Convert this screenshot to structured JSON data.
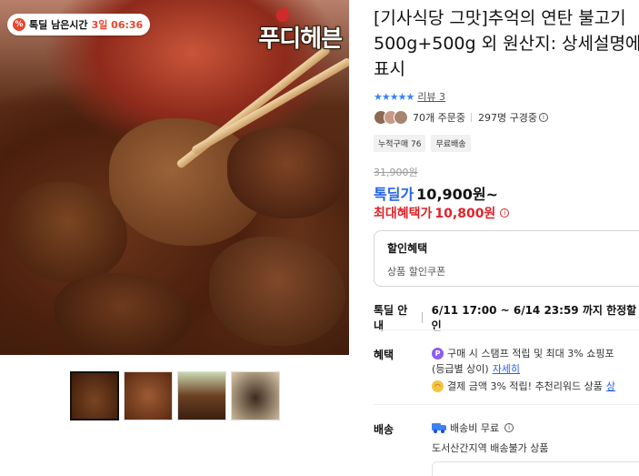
{
  "timer": {
    "icon": "percent-icon",
    "label": "톡딜 남은시간",
    "value": "3일 06:36"
  },
  "brand": {
    "name": "푸디헤븐"
  },
  "product": {
    "title": "[기사식당 그맛]추억의 연탄 불고기 500g+500g 외 원산지: 상세설명에 표시"
  },
  "rating": {
    "stars": "★★★★★",
    "review_label": "리뷰 3"
  },
  "buyers": {
    "orders": "70개 주문중",
    "subscribers": "297명 구경중"
  },
  "tags": [
    "누적구매 76",
    "무료배송"
  ],
  "price": {
    "original": "31,900원",
    "deal_label": "톡딜가",
    "deal_price": "10,900원~",
    "max_label": "최대혜택가",
    "max_price": "10,800원"
  },
  "discount": {
    "title": "할인혜택",
    "subtitle": "상품 할인쿠폰"
  },
  "deal_info": {
    "label": "톡딜 안내",
    "value": "6/11 17:00 ~ 6/14 23:59 까지 한정할인"
  },
  "benefits": {
    "label": "혜택",
    "line1": "구매 시 스탬프 적립 및 최대 3% 쇼핑포",
    "line2_text": "(등급별 상이)",
    "line2_link": "자세히",
    "line3_text": "결제 금액 3% 적립! 추천리워드 상품",
    "line3_link": "상"
  },
  "shipping": {
    "label": "배송",
    "line1": "배송비 무료",
    "line2": "도서산간지역 배송불가 상품"
  },
  "thumbnails": [
    "thumb-1",
    "thumb-2",
    "thumb-3",
    "thumb-4"
  ],
  "colors": {
    "accent_blue": "#2563eb",
    "accent_red": "#e0232b",
    "star": "#3b82f6"
  }
}
